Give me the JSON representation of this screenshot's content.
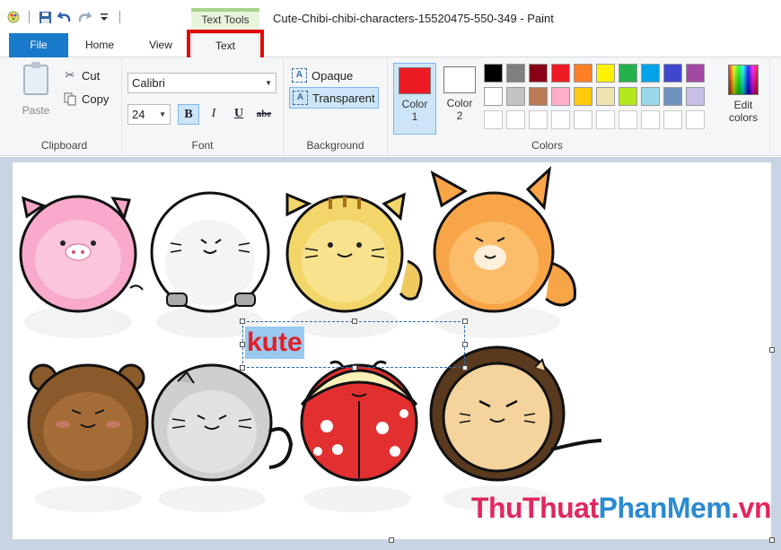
{
  "window": {
    "title": "Cute-Chibi-chibi-characters-15520475-550-349 - Paint",
    "contextual_tab_group": "Text Tools"
  },
  "tabs": {
    "file": "File",
    "home": "Home",
    "view": "View",
    "text": "Text"
  },
  "clipboard": {
    "paste": "Paste",
    "cut": "Cut",
    "copy": "Copy",
    "label": "Clipboard"
  },
  "font": {
    "family": "Calibri",
    "size": "24",
    "bold": "B",
    "italic": "I",
    "underline": "U",
    "strikethrough": "abe",
    "label": "Font"
  },
  "background": {
    "opaque": "Opaque",
    "transparent": "Transparent",
    "label": "Background"
  },
  "colors": {
    "color1_line1": "Color",
    "color1_line2": "1",
    "color2_line1": "Color",
    "color2_line2": "2",
    "color1_value": "#ed1c24",
    "color2_value": "#ffffff",
    "palette_row1": [
      "#000000",
      "#7f7f7f",
      "#880015",
      "#ed1c24",
      "#ff7f27",
      "#fff200",
      "#22b14c",
      "#00a2e8",
      "#3f48cc",
      "#a349a4"
    ],
    "palette_row2": [
      "#ffffff",
      "#c3c3c3",
      "#b97a57",
      "#ffaec9",
      "#ffc90e",
      "#efe4b0",
      "#b5e61d",
      "#99d9ea",
      "#7092be",
      "#c8bfe7"
    ],
    "edit_line1": "Edit",
    "edit_line2": "colors",
    "label": "Colors"
  },
  "canvas": {
    "text_content": "kute"
  },
  "watermark": {
    "part1": "ThuThuat",
    "part2": "PhanMem",
    "part3": ".vn"
  }
}
